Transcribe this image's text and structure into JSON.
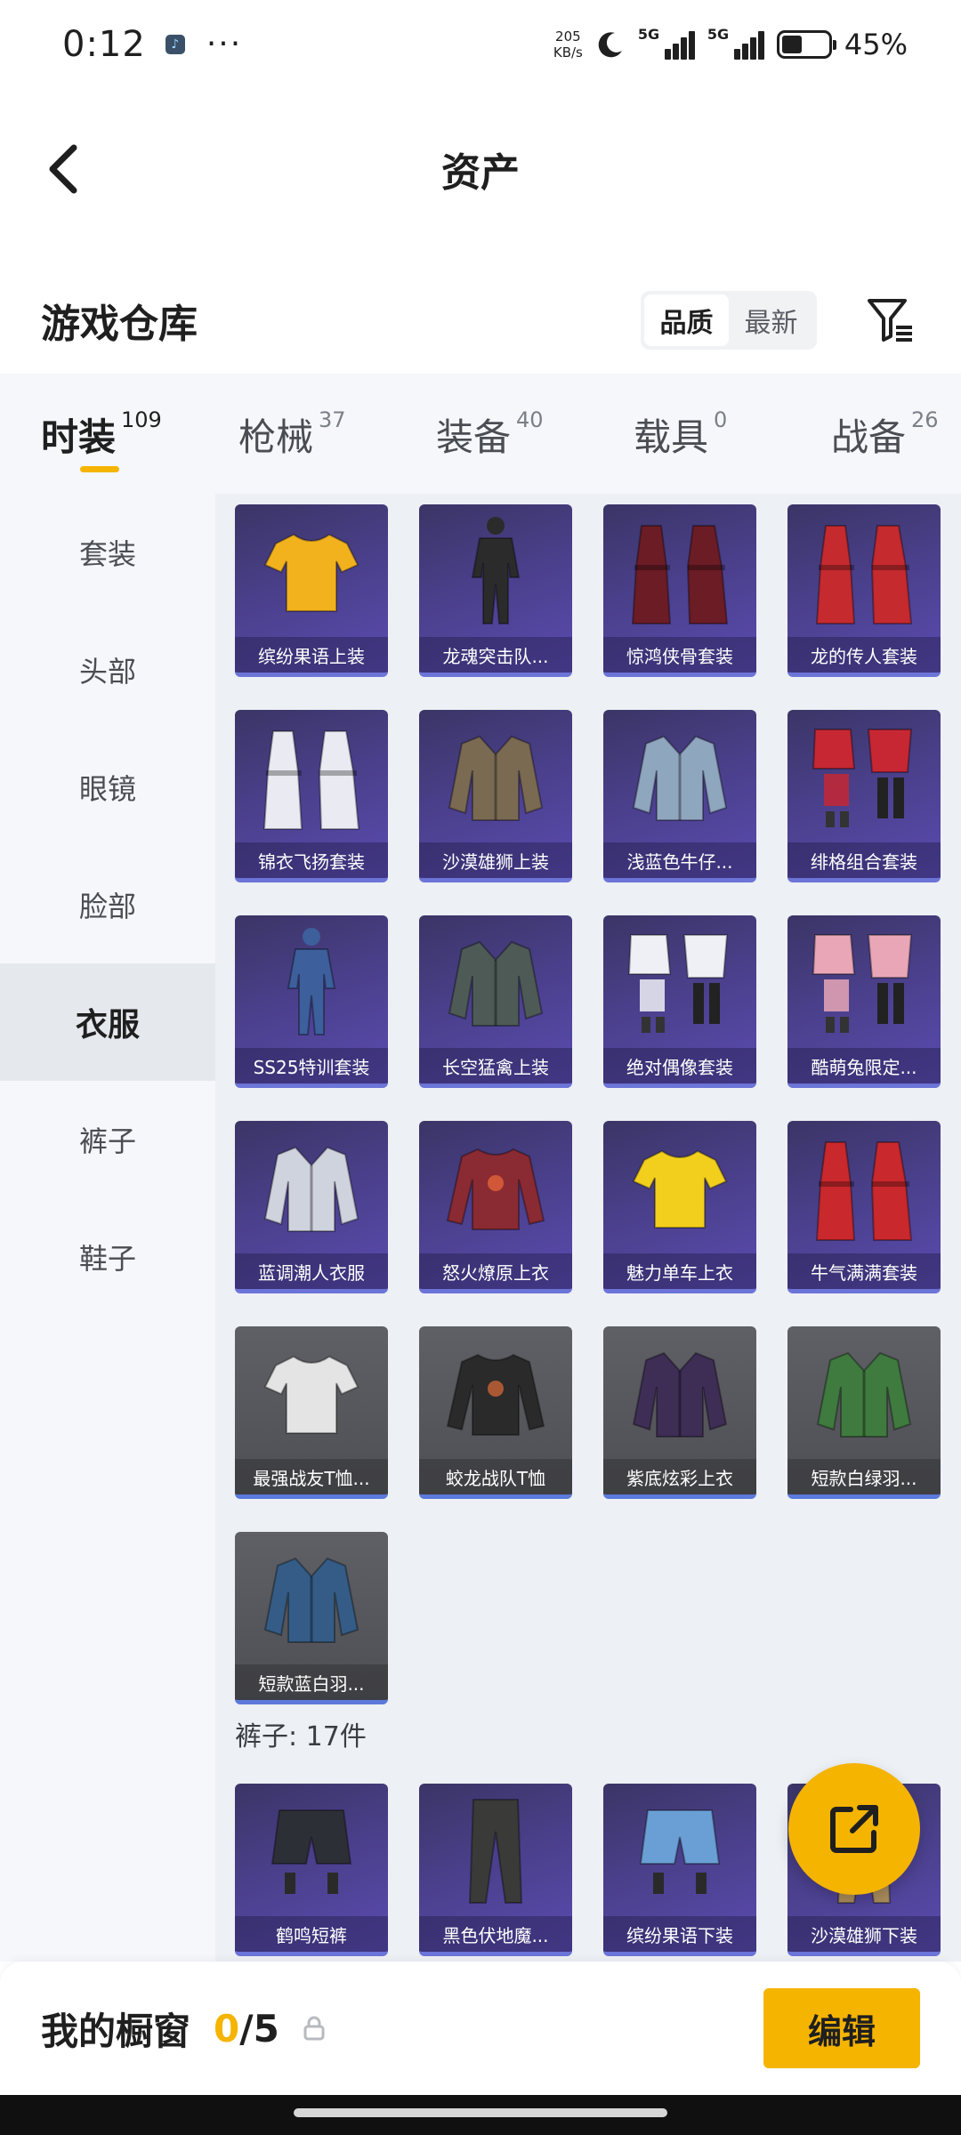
{
  "status_bar": {
    "time": "0:12",
    "net_speed_value": "205",
    "net_speed_unit": "KB/s",
    "sim1": "5G",
    "sim2": "5G",
    "battery": "45%",
    "battery_level": 0.45
  },
  "header": {
    "title": "资产",
    "back_icon": "chevron-left-icon"
  },
  "warehouse": {
    "title": "游戏仓库",
    "sort_options": [
      {
        "label": "品质",
        "active": true
      },
      {
        "label": "最新",
        "active": false
      }
    ],
    "filter_icon": "filter-icon"
  },
  "categories": [
    {
      "name": "时装",
      "count": "109",
      "active": true
    },
    {
      "name": "枪械",
      "count": "37",
      "active": false
    },
    {
      "name": "装备",
      "count": "40",
      "active": false
    },
    {
      "name": "载具",
      "count": "0",
      "active": false
    },
    {
      "name": "战备",
      "count": "26",
      "active": false
    }
  ],
  "side_nav": [
    {
      "label": "套装",
      "active": false
    },
    {
      "label": "头部",
      "active": false
    },
    {
      "label": "眼镜",
      "active": false
    },
    {
      "label": "脸部",
      "active": false
    },
    {
      "label": "衣服",
      "active": true
    },
    {
      "label": "裤子",
      "active": false
    },
    {
      "label": "鞋子",
      "active": false
    }
  ],
  "clothes_items": [
    {
      "name": "缤纷果语上装",
      "style": "purple",
      "art": "shirt",
      "color": "#f2b21e"
    },
    {
      "name": "龙魂突击队...",
      "style": "purple",
      "art": "figure",
      "color": "#2b2b2b"
    },
    {
      "name": "惊鸿侠骨套装",
      "style": "purple",
      "art": "robe",
      "color": "#6b1c25"
    },
    {
      "name": "龙的传人套装",
      "style": "purple",
      "art": "robe",
      "color": "#c52a2e"
    },
    {
      "name": "锦衣飞扬套装",
      "style": "purple",
      "art": "robe",
      "color": "#e9eaf2"
    },
    {
      "name": "沙漠雄狮上装",
      "style": "purple",
      "art": "jacket",
      "color": "#7a6a52"
    },
    {
      "name": "浅蓝色牛仔...",
      "style": "purple",
      "art": "jacket",
      "color": "#8fa6bf"
    },
    {
      "name": "绯格组合套装",
      "style": "purple",
      "art": "set",
      "color": "#c62733"
    },
    {
      "name": "SS25特训套装",
      "style": "purple",
      "art": "figure",
      "color": "#3d5f9c"
    },
    {
      "name": "长空猛禽上装",
      "style": "purple",
      "art": "jacket",
      "color": "#4e5a56"
    },
    {
      "name": "绝对偶像套装",
      "style": "purple",
      "art": "set",
      "color": "#eef0f6"
    },
    {
      "name": "酷萌兔限定...",
      "style": "purple",
      "art": "set",
      "color": "#e8a6b6"
    },
    {
      "name": "蓝调潮人衣服",
      "style": "purple",
      "art": "jacket",
      "color": "#cfd3dd"
    },
    {
      "name": "怒火燎原上衣",
      "style": "purple",
      "art": "longsleeve",
      "color": "#8a2a32"
    },
    {
      "name": "魅力单车上衣",
      "style": "purple",
      "art": "shirt",
      "color": "#f2cf1c"
    },
    {
      "name": "牛气满满套装",
      "style": "purple",
      "art": "robe",
      "color": "#c9282c"
    },
    {
      "name": "最强战友T恤...",
      "style": "gray",
      "art": "shirt",
      "color": "#e4e4e4"
    },
    {
      "name": "蛟龙战队T恤",
      "style": "gray",
      "art": "longsleeve",
      "color": "#2a2a2a"
    },
    {
      "name": "紫底炫彩上衣",
      "style": "gray",
      "art": "jacket",
      "color": "#3e2d55"
    },
    {
      "name": "短款白绿羽...",
      "style": "gray",
      "art": "jacket",
      "color": "#3f7a3f"
    },
    {
      "name": "短款蓝白羽...",
      "style": "gray",
      "art": "jacket",
      "color": "#345c86"
    }
  ],
  "pants_section": {
    "header": "裤子: 17件",
    "items": [
      {
        "name": "鹤鸣短裤",
        "style": "purple",
        "art": "shorts",
        "color": "#2d2f36"
      },
      {
        "name": "黑色伏地魔...",
        "style": "purple",
        "art": "pants",
        "color": "#3a3a38"
      },
      {
        "name": "缤纷果语下装",
        "style": "purple",
        "art": "shorts",
        "color": "#6a9fd6"
      },
      {
        "name": "沙漠雄狮下装",
        "style": "purple",
        "art": "pants",
        "color": "#a88b5a"
      }
    ]
  },
  "fab_icon": "share-external-icon",
  "showcase": {
    "label": "我的橱窗",
    "used": "0",
    "total": "/5",
    "lock_icon": "lock-icon",
    "edit_label": "编辑"
  }
}
